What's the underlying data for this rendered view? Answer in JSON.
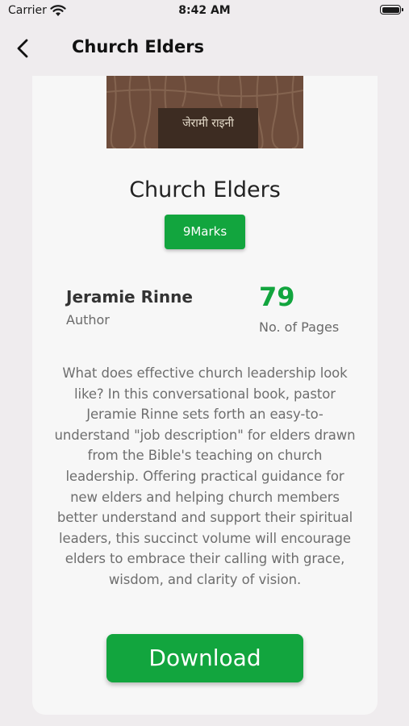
{
  "status_bar": {
    "carrier": "Carrier",
    "time": "8:42 AM"
  },
  "nav": {
    "title": "Church Elders"
  },
  "book": {
    "cover_label": "जेरामी राइनी",
    "title": "Church Elders",
    "publisher": "9Marks",
    "author_name": "Jeramie Rinne",
    "author_label": "Author",
    "pages": "79",
    "pages_label": "No. of Pages",
    "description": "What does effective church leadership look like? In this conversational book, pastor Jeramie Rinne sets forth an easy-to-understand \"job description\" for elders drawn from the Bible's teaching on church leadership. Offering practical guidance for new elders and helping church members better understand and support their spiritual leaders, this succinct volume will encourage elders to embrace their calling with grace, wisdom, and clarity of vision."
  },
  "actions": {
    "download_label": "Download"
  },
  "colors": {
    "accent": "#12a53e",
    "background": "#efecee",
    "card": "#f7f7f7"
  }
}
